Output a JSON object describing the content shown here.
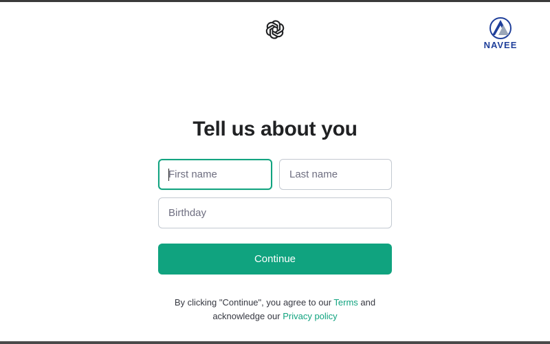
{
  "brand": {
    "logo_icon": "openai-logo-icon",
    "watermark_text": "NAVEE",
    "watermark_icon": "navee-logo-icon",
    "watermark_color": "#1f3f9a"
  },
  "form": {
    "title": "Tell us about you",
    "first_name_placeholder": "First name",
    "last_name_placeholder": "Last name",
    "birthday_placeholder": "Birthday",
    "focused_field": "first-name"
  },
  "actions": {
    "continue_label": "Continue"
  },
  "legal": {
    "prefix": "By clicking \"Continue\", you agree to our ",
    "terms_label": "Terms",
    "middle": " and",
    "line2_prefix": "acknowledge our ",
    "privacy_label": "Privacy policy"
  },
  "colors": {
    "accent": "#10a37f",
    "title": "#202123",
    "border": "#c2c8d0",
    "placeholder": "#6e6e80"
  }
}
